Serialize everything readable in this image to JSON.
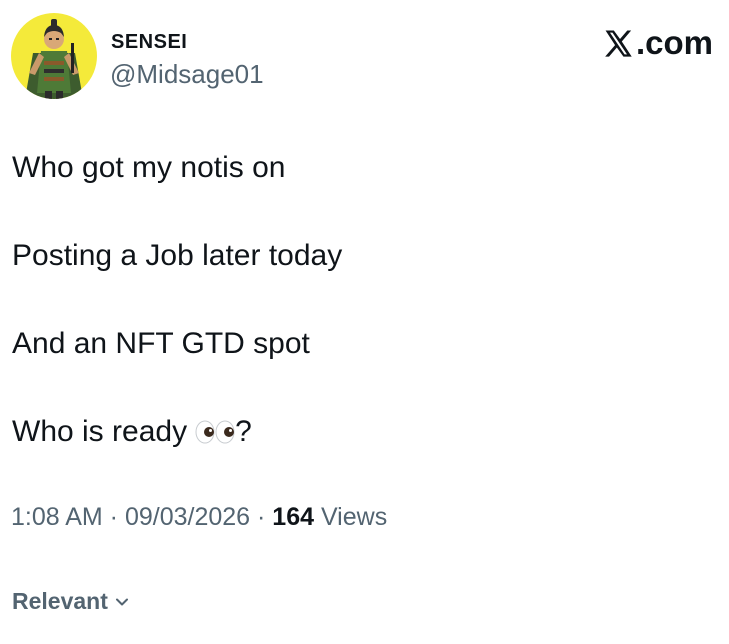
{
  "author": {
    "display_name": "SENSEI",
    "handle": "@Midsage01",
    "avatar_icon": "ninja-character-avatar",
    "avatar_bg": "#f4ea3a"
  },
  "brand": {
    "label": ".com",
    "icon": "x-logo-icon"
  },
  "tweet": {
    "lines": [
      "Who got my notis on",
      "Posting a Job later today",
      "And an NFT GTD spot",
      "Who is ready",
      "?"
    ],
    "emoji": "eyes-emoji"
  },
  "meta": {
    "time": "1:08 AM",
    "sep1": " · ",
    "date": "09/03/2026",
    "sep2": " · ",
    "views_count": "164",
    "views_label": " Views"
  },
  "sort": {
    "label": "Relevant",
    "icon": "chevron-down-icon"
  },
  "colors": {
    "text": "#0f1419",
    "secondary": "#536471"
  }
}
